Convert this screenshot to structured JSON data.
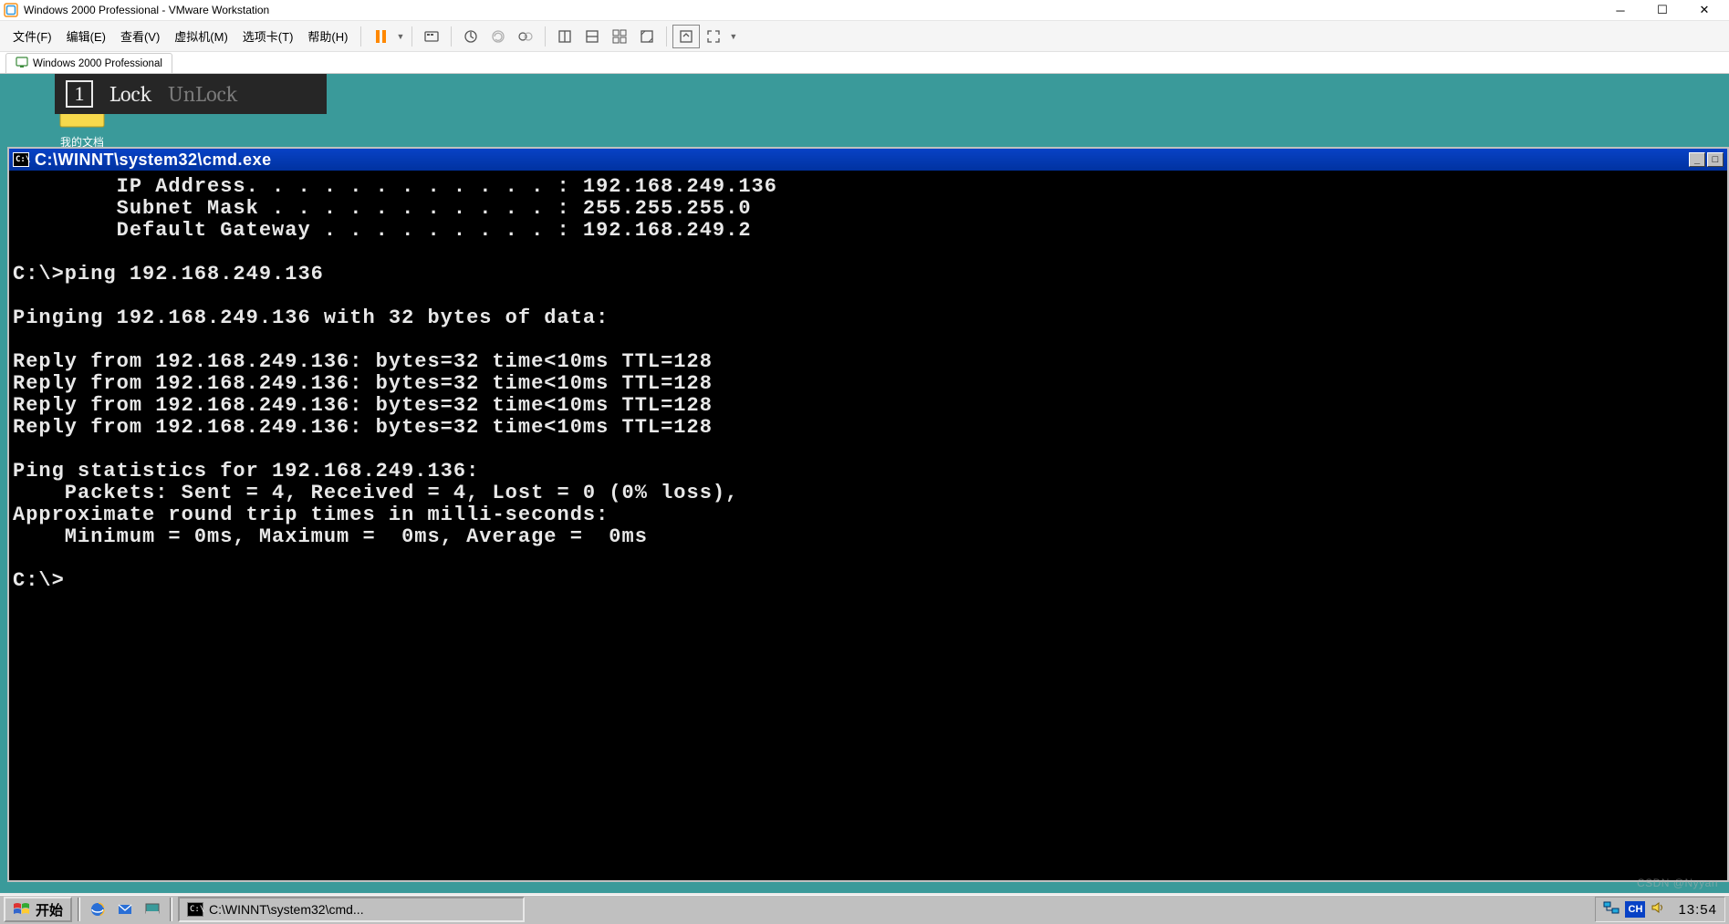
{
  "outer": {
    "title": "Windows 2000 Professional - VMware Workstation",
    "menu": [
      "文件(F)",
      "编辑(E)",
      "查看(V)",
      "虚拟机(M)",
      "选项卡(T)",
      "帮助(H)"
    ],
    "tab_label": "Windows 2000 Professional"
  },
  "overlay": {
    "number": "1",
    "lock": "Lock",
    "unlock": "UnLock"
  },
  "desktop": {
    "icon_label": "我的文档"
  },
  "cmd": {
    "title_path": "C:\\WINNT\\system32\\cmd.exe",
    "lines": [
      "        IP Address. . . . . . . . . . . . : 192.168.249.136",
      "        Subnet Mask . . . . . . . . . . . : 255.255.255.0",
      "        Default Gateway . . . . . . . . . : 192.168.249.2",
      "",
      "C:\\>ping 192.168.249.136",
      "",
      "Pinging 192.168.249.136 with 32 bytes of data:",
      "",
      "Reply from 192.168.249.136: bytes=32 time<10ms TTL=128",
      "Reply from 192.168.249.136: bytes=32 time<10ms TTL=128",
      "Reply from 192.168.249.136: bytes=32 time<10ms TTL=128",
      "Reply from 192.168.249.136: bytes=32 time<10ms TTL=128",
      "",
      "Ping statistics for 192.168.249.136:",
      "    Packets: Sent = 4, Received = 4, Lost = 0 (0% loss),",
      "Approximate round trip times in milli-seconds:",
      "    Minimum = 0ms, Maximum =  0ms, Average =  0ms",
      "",
      "C:\\>"
    ]
  },
  "taskbar": {
    "start": "开始",
    "task_label": "C:\\WINNT\\system32\\cmd...",
    "ime": "CH",
    "clock": "13:54"
  },
  "watermark": "CSDN @Nyyan"
}
